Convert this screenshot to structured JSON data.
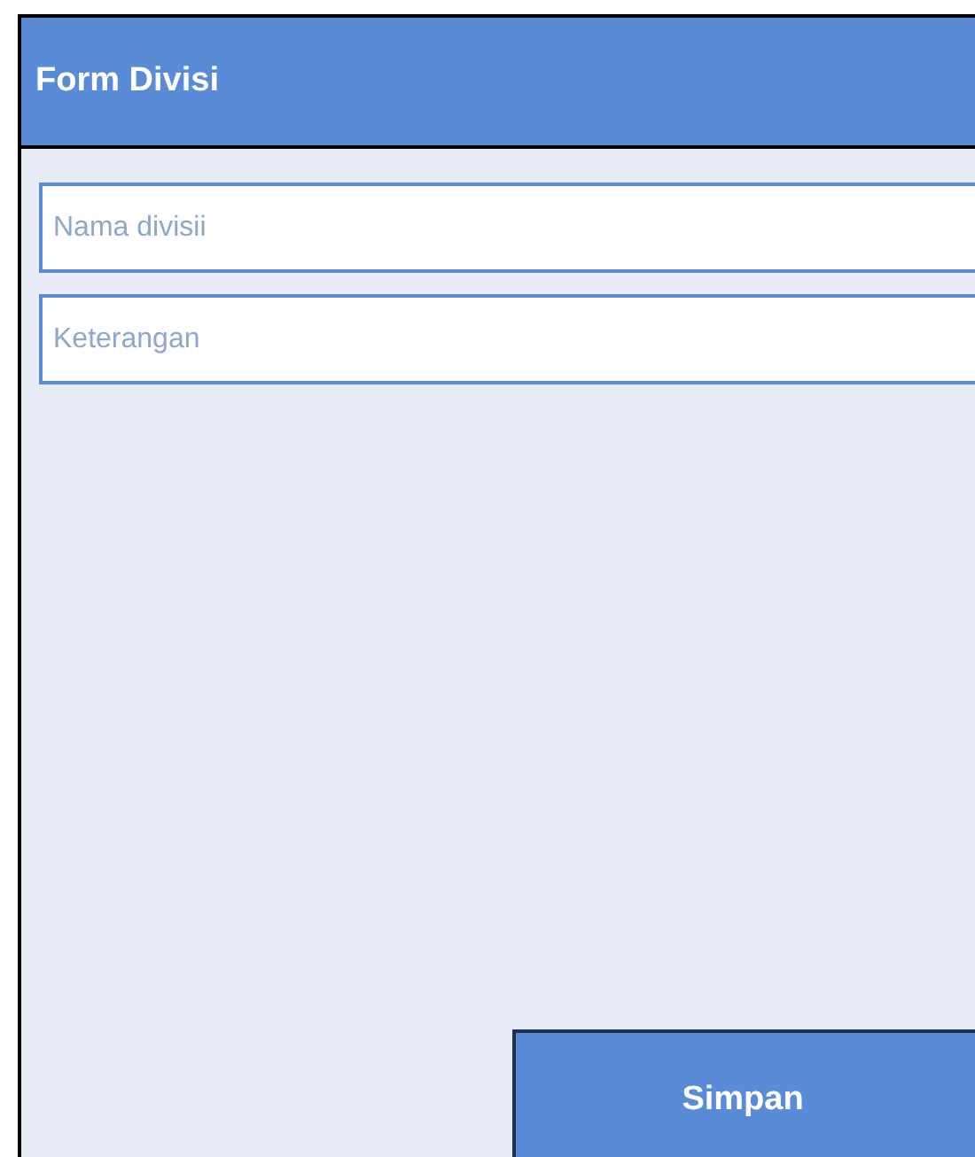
{
  "header": {
    "title": "Form Divisi"
  },
  "fields": [
    {
      "placeholder": "Nama divisii"
    },
    {
      "placeholder": "Keterangan"
    }
  ],
  "button": {
    "label": "Simpan"
  }
}
